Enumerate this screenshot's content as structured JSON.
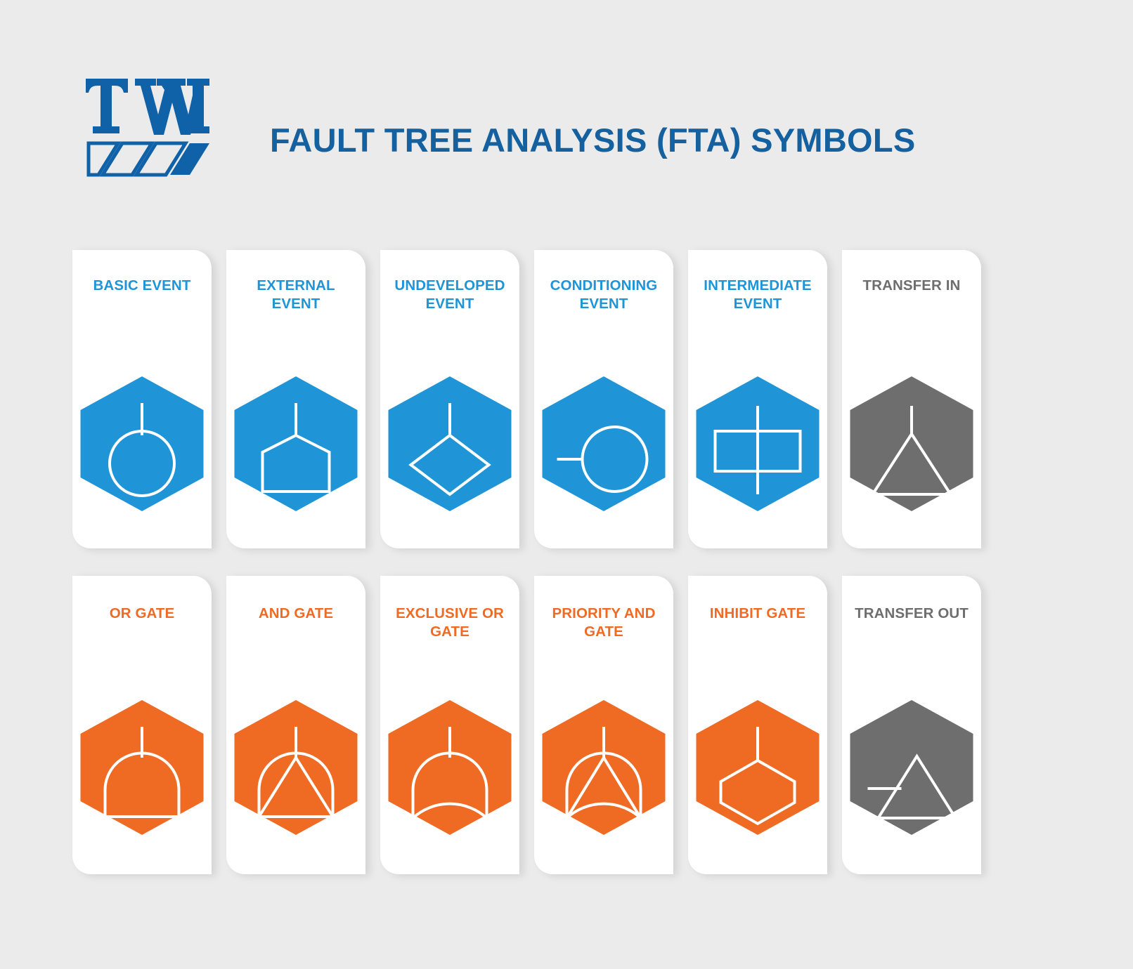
{
  "header": {
    "logo_text": "TWI",
    "logo_name": "twi-logo",
    "title": "FAULT TREE ANALYSIS (FTA) SYMBOLS"
  },
  "colors": {
    "background": "#ebebeb",
    "card": "#ffffff",
    "title_blue": "#15609f",
    "event_blue": "#1f94d6",
    "gate_orange": "#ef6a23",
    "transfer_gray": "#6e6e6e",
    "symbol_stroke": "#ffffff"
  },
  "rows": [
    {
      "name": "events-row",
      "cards": [
        {
          "label": "BASIC EVENT",
          "label_color": "blue",
          "hex_color": "#1f94d6",
          "symbol": "circle-with-stem"
        },
        {
          "label": "EXTERNAL EVENT",
          "label_color": "blue",
          "hex_color": "#1f94d6",
          "symbol": "house-with-stem"
        },
        {
          "label": "UNDEVELOPED EVENT",
          "label_color": "blue",
          "hex_color": "#1f94d6",
          "symbol": "diamond-with-stem"
        },
        {
          "label": "CONDITIONING EVENT",
          "label_color": "blue",
          "hex_color": "#1f94d6",
          "symbol": "oval-with-side-line"
        },
        {
          "label": "INTERMEDIATE EVENT",
          "label_color": "blue",
          "hex_color": "#1f94d6",
          "symbol": "rectangle-with-through-line"
        },
        {
          "label": "TRANSFER IN",
          "label_color": "gray",
          "hex_color": "#6e6e6e",
          "symbol": "triangle-with-top-stem"
        }
      ]
    },
    {
      "name": "gates-row",
      "cards": [
        {
          "label": "OR GATE",
          "label_color": "orange",
          "hex_color": "#ef6a23",
          "symbol": "or-arch"
        },
        {
          "label": "AND GATE",
          "label_color": "orange",
          "hex_color": "#ef6a23",
          "symbol": "and-arch-triangle"
        },
        {
          "label": "EXCLUSIVE OR GATE",
          "label_color": "orange",
          "hex_color": "#ef6a23",
          "symbol": "xor-arch-concave"
        },
        {
          "label": "PRIORITY AND GATE",
          "label_color": "orange",
          "hex_color": "#ef6a23",
          "symbol": "priority-and-arch"
        },
        {
          "label": "INHIBIT GATE",
          "label_color": "orange",
          "hex_color": "#ef6a23",
          "symbol": "inner-hexagon-with-stem"
        },
        {
          "label": "TRANSFER OUT",
          "label_color": "gray",
          "hex_color": "#6e6e6e",
          "symbol": "triangle-with-side-line"
        }
      ]
    }
  ]
}
